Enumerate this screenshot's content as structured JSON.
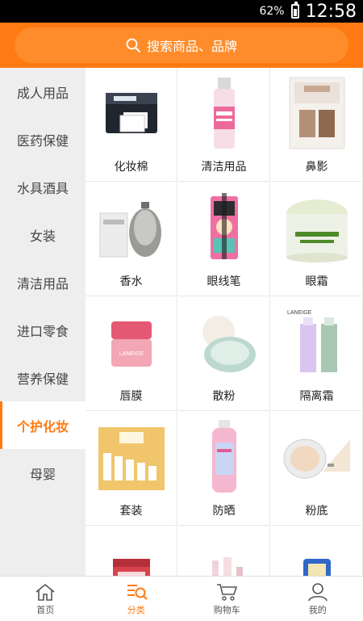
{
  "status": {
    "battery": "62%",
    "battery_level": 0.62,
    "time": "12:58"
  },
  "search": {
    "placeholder": "搜索商品、品牌"
  },
  "sidebar": {
    "active_index": 7,
    "items": [
      {
        "label": "成人用品"
      },
      {
        "label": "医药保健"
      },
      {
        "label": "水具酒具"
      },
      {
        "label": "女装"
      },
      {
        "label": "清洁用品"
      },
      {
        "label": "进口零食"
      },
      {
        "label": "营养保健"
      },
      {
        "label": "个护化妆"
      },
      {
        "label": "母婴"
      }
    ]
  },
  "products": [
    {
      "label": "化妆棉",
      "icon": "cotton-pads-icon"
    },
    {
      "label": "清洁用品",
      "icon": "cleanser-bottle-icon"
    },
    {
      "label": "鼻影",
      "icon": "nose-shadow-icon"
    },
    {
      "label": "香水",
      "icon": "perfume-icon"
    },
    {
      "label": "眼线笔",
      "icon": "eyeliner-icon"
    },
    {
      "label": "眼霜",
      "icon": "eye-cream-icon"
    },
    {
      "label": "唇膜",
      "icon": "lip-mask-icon"
    },
    {
      "label": "散粉",
      "icon": "loose-powder-icon"
    },
    {
      "label": "隔离霜",
      "icon": "primer-icon"
    },
    {
      "label": "套装",
      "icon": "gift-set-icon"
    },
    {
      "label": "防晒",
      "icon": "sunscreen-icon"
    },
    {
      "label": "粉底",
      "icon": "foundation-icon"
    },
    {
      "label": "",
      "icon": "mask-jar-icon"
    },
    {
      "label": "",
      "icon": "lipstick-icon"
    },
    {
      "label": "",
      "icon": "blue-tube-icon"
    }
  ],
  "image_text": {
    "laneige_a": "LANEIGE",
    "laneige_b": "LANEIGE"
  },
  "bottom_nav": {
    "active_index": 1,
    "items": [
      {
        "label": "首页",
        "icon": "home-icon"
      },
      {
        "label": "分类",
        "icon": "category-icon"
      },
      {
        "label": "购物车",
        "icon": "cart-icon"
      },
      {
        "label": "我的",
        "icon": "profile-icon"
      }
    ]
  },
  "colors": {
    "accent": "#ff7a12",
    "sidebar_bg": "#eeeeee"
  }
}
